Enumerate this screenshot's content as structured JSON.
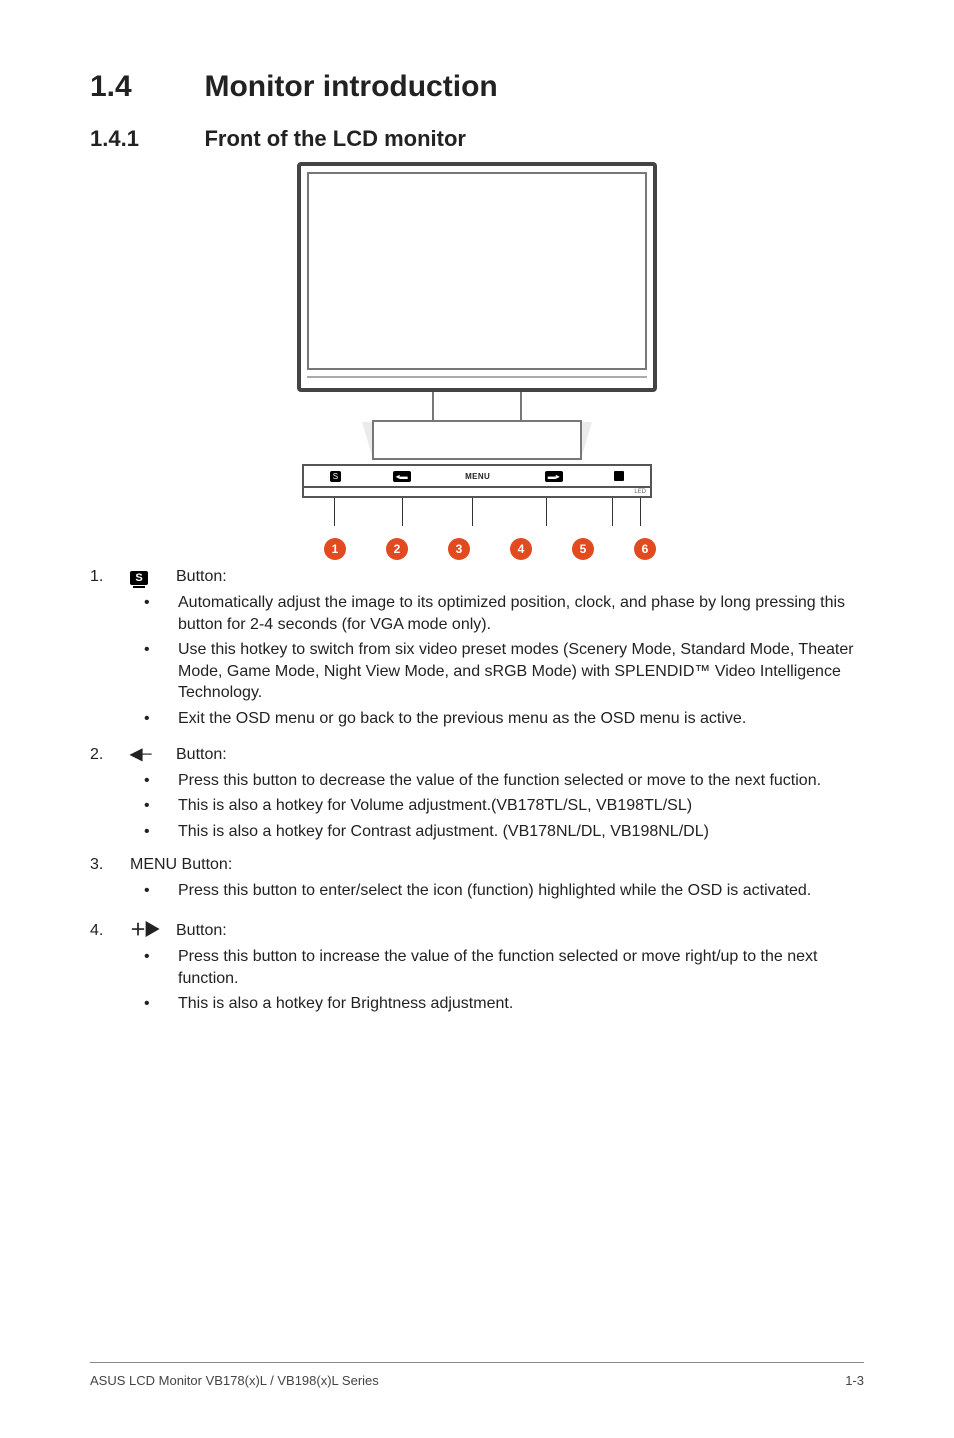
{
  "section": {
    "num": "1.4",
    "title": "Monitor introduction"
  },
  "subsection": {
    "num": "1.4.1",
    "title": "Front of the LCD monitor"
  },
  "figure": {
    "panel_labels": {
      "b1": "S",
      "b2": "◂▬",
      "b3": "MENU",
      "b4": "▬▸",
      "b5": "⏻"
    },
    "callouts": [
      "1",
      "2",
      "3",
      "4",
      "5",
      "6"
    ],
    "led_text": "LED"
  },
  "items": [
    {
      "num": "1.",
      "icon_kind": "splendid",
      "icon_text": "S",
      "label": "Button:",
      "bullets": [
        "Automatically adjust the image to its optimized position, clock, and phase by long pressing this button for 2-4 seconds (for VGA mode only).",
        "Use this hotkey to switch from six video preset modes (Scenery Mode, Standard Mode, Theater Mode, Game Mode, Night View Mode, and sRGB Mode) with SPLENDID™ Video Intelligence Technology.",
        "Exit the OSD menu or go back to the previous menu as the OSD menu is active."
      ]
    },
    {
      "num": "2.",
      "icon_kind": "arrow-left",
      "icon_text": "◀─",
      "label": "Button:",
      "bullets": [
        "Press this button to decrease the value of the function selected or move to the next fuction.",
        "This is also a hotkey for Volume adjustment.(VB178TL/SL, VB198TL/SL)",
        "This is also a hotkey for Contrast adjustment. (VB178NL/DL, VB198NL/DL)"
      ]
    },
    {
      "num": "3.",
      "icon_kind": "none",
      "icon_text": "",
      "label": "MENU Button:",
      "bullets": [
        "Press this button to enter/select the icon (function) highlighted while the OSD is activated."
      ]
    },
    {
      "num": "4.",
      "icon_kind": "arrow-right",
      "icon_text": "＋▶",
      "label": "Button:",
      "bullets": [
        "Press this button to increase the value of the function selected or move right/up to the next function.",
        "This is also a hotkey for Brightness adjustment."
      ]
    }
  ],
  "footer": {
    "left": "ASUS LCD Monitor VB178(x)L / VB198(x)L Series",
    "right": "1-3"
  }
}
